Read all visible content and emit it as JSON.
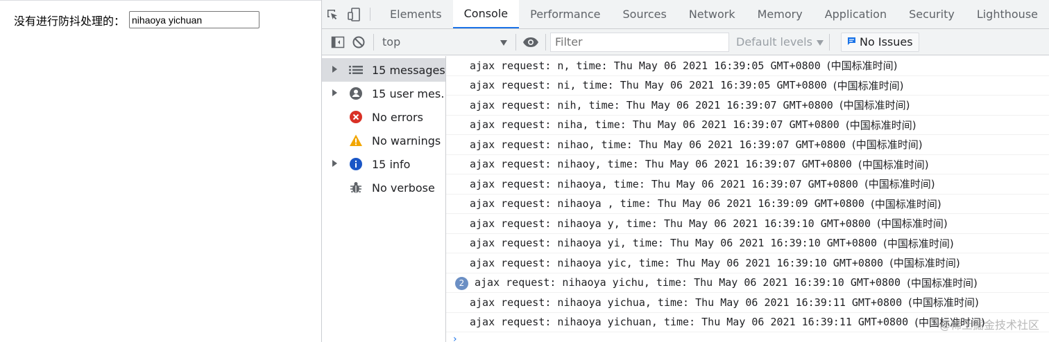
{
  "page": {
    "label": "没有进行防抖处理的：",
    "input_value": "nihaoya yichuan"
  },
  "devtools": {
    "tabs": [
      "Elements",
      "Console",
      "Performance",
      "Sources",
      "Network",
      "Memory",
      "Application",
      "Security",
      "Lighthouse"
    ],
    "active_tab": "Console",
    "toolbar": {
      "context": "top",
      "filter_placeholder": "Filter",
      "levels": "Default levels",
      "issues": "No Issues"
    },
    "sidebar": [
      {
        "label": "15 messages",
        "icon": "list-icon",
        "expandable": true,
        "selected": true
      },
      {
        "label": "15 user mes…",
        "icon": "user-icon",
        "expandable": true,
        "selected": false
      },
      {
        "label": "No errors",
        "icon": "error-icon",
        "expandable": false,
        "selected": false
      },
      {
        "label": "No warnings",
        "icon": "warning-icon",
        "expandable": false,
        "selected": false
      },
      {
        "label": "15 info",
        "icon": "info-icon",
        "expandable": true,
        "selected": false
      },
      {
        "label": "No verbose",
        "icon": "bug-icon",
        "expandable": false,
        "selected": false
      }
    ],
    "messages": [
      {
        "text": "ajax request: n, time: Thu May 06 2021 16:39:05 GMT+0800 ",
        "tz": "(中国标准时间)"
      },
      {
        "text": "ajax request: ni, time: Thu May 06 2021 16:39:05 GMT+0800 ",
        "tz": "(中国标准时间)"
      },
      {
        "text": "ajax request: nih, time: Thu May 06 2021 16:39:07 GMT+0800 ",
        "tz": "(中国标准时间)"
      },
      {
        "text": "ajax request: niha, time: Thu May 06 2021 16:39:07 GMT+0800 ",
        "tz": "(中国标准时间)"
      },
      {
        "text": "ajax request: nihao, time: Thu May 06 2021 16:39:07 GMT+0800 ",
        "tz": "(中国标准时间)"
      },
      {
        "text": "ajax request: nihaoy, time: Thu May 06 2021 16:39:07 GMT+0800 ",
        "tz": "(中国标准时间)"
      },
      {
        "text": "ajax request: nihaoya, time: Thu May 06 2021 16:39:07 GMT+0800 ",
        "tz": "(中国标准时间)"
      },
      {
        "text": "ajax request: nihaoya , time: Thu May 06 2021 16:39:09 GMT+0800 ",
        "tz": "(中国标准时间)"
      },
      {
        "text": "ajax request: nihaoya y, time: Thu May 06 2021 16:39:10 GMT+0800 ",
        "tz": "(中国标准时间)"
      },
      {
        "text": "ajax request: nihaoya yi, time: Thu May 06 2021 16:39:10 GMT+0800 ",
        "tz": "(中国标准时间)"
      },
      {
        "text": "ajax request: nihaoya yic, time: Thu May 06 2021 16:39:10 GMT+0800 ",
        "tz": "(中国标准时间)"
      },
      {
        "text": "ajax request: nihaoya yichu, time: Thu May 06 2021 16:39:10 GMT+0800 ",
        "tz": "(中国标准时间)",
        "count": "2"
      },
      {
        "text": "ajax request: nihaoya yichua, time: Thu May 06 2021 16:39:11 GMT+0800 ",
        "tz": "(中国标准时间)"
      },
      {
        "text": "ajax request: nihaoya yichuan, time: Thu May 06 2021 16:39:11 GMT+0800 ",
        "tz": "(中国标准时间)"
      }
    ],
    "prompt": "›"
  },
  "watermark": "@稀土掘金技术社区",
  "colors": {
    "accent": "#1a73e8",
    "error": "#d93025",
    "warning": "#f2a600",
    "info": "#1a73e8"
  }
}
